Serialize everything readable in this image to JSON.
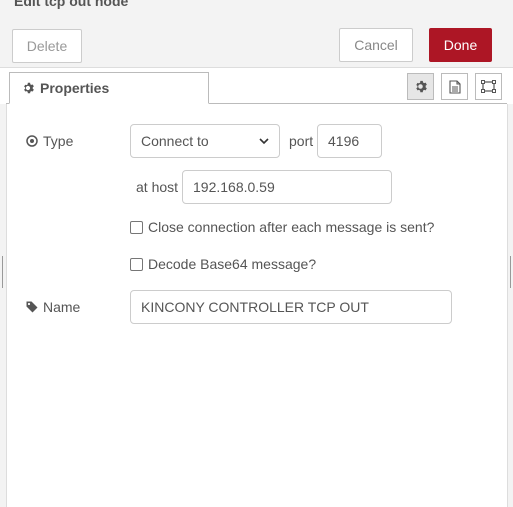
{
  "tray": {
    "title": "Edit tcp out node",
    "delete_label": "Delete",
    "cancel_label": "Cancel",
    "done_label": "Done"
  },
  "tabs": {
    "properties_label": "Properties",
    "icon_buttons": [
      "gear-icon",
      "description-icon",
      "appearance-icon"
    ]
  },
  "form": {
    "type_label": "Type",
    "type_value": "Connect to",
    "port_label": "port",
    "port_value": "4196",
    "host_label": "at host",
    "host_value": "192.168.0.59",
    "close_connection_label": "Close connection after each message is sent?",
    "close_connection_checked": false,
    "decode_base64_label": "Decode Base64 message?",
    "decode_base64_checked": false,
    "name_label": "Name",
    "name_value": "KINCONY CONTROLLER TCP OUT"
  },
  "colors": {
    "done_button": "#ad1625",
    "header_background": "#f3f3f3"
  }
}
